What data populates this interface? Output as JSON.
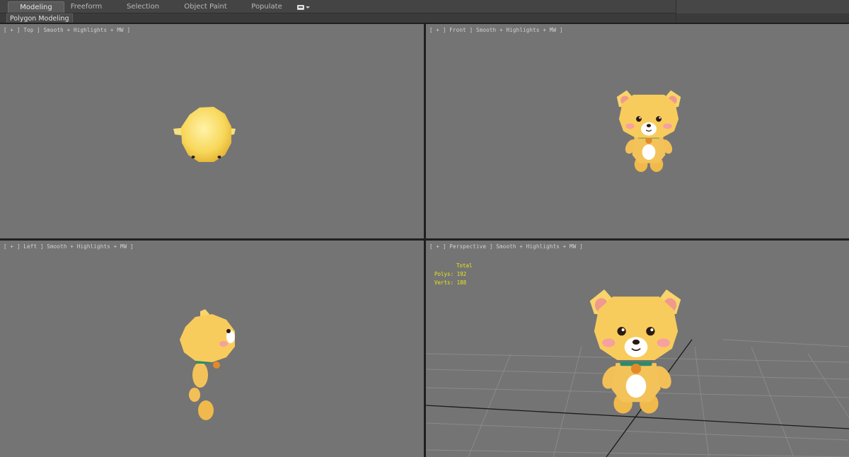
{
  "ribbon": {
    "tabs": [
      {
        "label": "Modeling",
        "active": true
      },
      {
        "label": "Freeform",
        "active": false
      },
      {
        "label": "Selection",
        "active": false
      },
      {
        "label": "Object Paint",
        "active": false
      },
      {
        "label": "Populate",
        "active": false
      }
    ],
    "extra_icon": "ribbon-display-dropdown-icon"
  },
  "panel": {
    "label": "Polygon Modeling"
  },
  "viewports": {
    "top": {
      "label": "[ + ] Top ] Smooth + Highlights + MW ]"
    },
    "front": {
      "label": "[ + ] Front ] Smooth + Highlights + MW ]"
    },
    "left": {
      "label": "[ + ] Left ] Smooth + Highlights + MW ]"
    },
    "perspective": {
      "label": "[ + ] Perspective ] Smooth + Highlights + MW ]",
      "stats": {
        "header": "Total",
        "polys_label": "Polys:",
        "polys_value": "192",
        "verts_label": "Verts:",
        "verts_value": "188"
      }
    }
  },
  "colors": {
    "viewport_bg": "#747474",
    "bear_fur": "#f2c45d",
    "bear_belly": "#ffffff",
    "bear_cheek": "#f6a6a6",
    "stats_text": "#e7e41a"
  }
}
